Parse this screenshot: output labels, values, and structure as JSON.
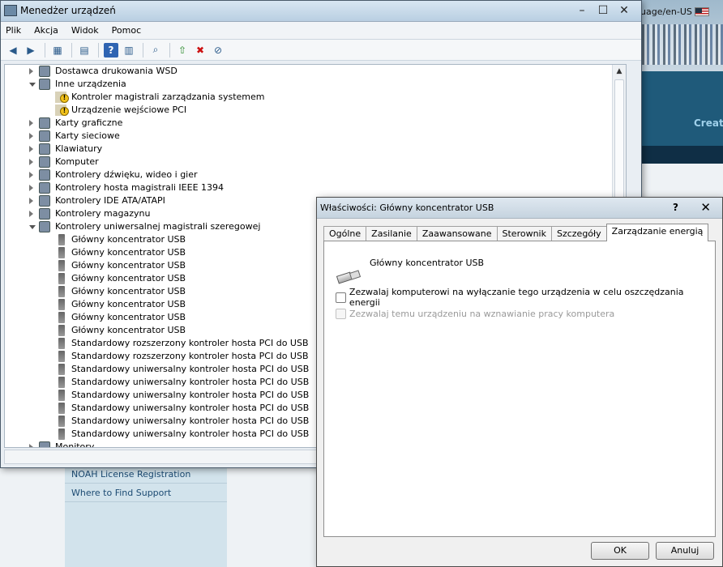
{
  "background": {
    "url_fragment": "uage/en-US",
    "band_text": "Creat",
    "links": [
      "NOAH License Registration",
      "Where to Find Support"
    ]
  },
  "device_manager": {
    "title": "Menedżer urządzeń",
    "menu": [
      "Plik",
      "Akcja",
      "Widok",
      "Pomoc"
    ],
    "tree": [
      {
        "label": "Dostawca drukowania WSD",
        "level": 0,
        "state": "closed",
        "icon": "printer-icon"
      },
      {
        "label": "Inne urządzenia",
        "level": 0,
        "state": "open",
        "icon": "unknown-device-icon"
      },
      {
        "label": "Kontroler magistrali zarządzania systemem",
        "level": 1,
        "state": "none",
        "icon": "warning-device-icon"
      },
      {
        "label": "Urządzenie wejściowe PCI",
        "level": 1,
        "state": "none",
        "icon": "warning-device-icon"
      },
      {
        "label": "Karty graficzne",
        "level": 0,
        "state": "closed",
        "icon": "display-adapter-icon"
      },
      {
        "label": "Karty sieciowe",
        "level": 0,
        "state": "closed",
        "icon": "network-adapter-icon"
      },
      {
        "label": "Klawiatury",
        "level": 0,
        "state": "closed",
        "icon": "keyboard-icon"
      },
      {
        "label": "Komputer",
        "level": 0,
        "state": "closed",
        "icon": "computer-icon"
      },
      {
        "label": "Kontrolery dźwięku, wideo i gier",
        "level": 0,
        "state": "closed",
        "icon": "sound-icon"
      },
      {
        "label": "Kontrolery hosta magistrali IEEE 1394",
        "level": 0,
        "state": "closed",
        "icon": "firewire-icon"
      },
      {
        "label": "Kontrolery IDE ATA/ATAPI",
        "level": 0,
        "state": "closed",
        "icon": "ide-controller-icon"
      },
      {
        "label": "Kontrolery magazynu",
        "level": 0,
        "state": "closed",
        "icon": "storage-controller-icon"
      },
      {
        "label": "Kontrolery uniwersalnej magistrali szeregowej",
        "level": 0,
        "state": "open",
        "icon": "usb-icon"
      },
      {
        "label": "Główny koncentrator USB",
        "level": 1,
        "state": "none",
        "icon": "usb-icon"
      },
      {
        "label": "Główny koncentrator USB",
        "level": 1,
        "state": "none",
        "icon": "usb-icon"
      },
      {
        "label": "Główny koncentrator USB",
        "level": 1,
        "state": "none",
        "icon": "usb-icon"
      },
      {
        "label": "Główny koncentrator USB",
        "level": 1,
        "state": "none",
        "icon": "usb-icon"
      },
      {
        "label": "Główny koncentrator USB",
        "level": 1,
        "state": "none",
        "icon": "usb-icon"
      },
      {
        "label": "Główny koncentrator USB",
        "level": 1,
        "state": "none",
        "icon": "usb-icon"
      },
      {
        "label": "Główny koncentrator USB",
        "level": 1,
        "state": "none",
        "icon": "usb-icon"
      },
      {
        "label": "Główny koncentrator USB",
        "level": 1,
        "state": "none",
        "icon": "usb-icon"
      },
      {
        "label": "Standardowy rozszerzony kontroler hosta PCI do USB",
        "level": 1,
        "state": "none",
        "icon": "usb-icon"
      },
      {
        "label": "Standardowy rozszerzony kontroler hosta PCI do USB",
        "level": 1,
        "state": "none",
        "icon": "usb-icon"
      },
      {
        "label": "Standardowy uniwersalny kontroler hosta PCI do USB",
        "level": 1,
        "state": "none",
        "icon": "usb-icon"
      },
      {
        "label": "Standardowy uniwersalny kontroler hosta PCI do USB",
        "level": 1,
        "state": "none",
        "icon": "usb-icon"
      },
      {
        "label": "Standardowy uniwersalny kontroler hosta PCI do USB",
        "level": 1,
        "state": "none",
        "icon": "usb-icon"
      },
      {
        "label": "Standardowy uniwersalny kontroler hosta PCI do USB",
        "level": 1,
        "state": "none",
        "icon": "usb-icon"
      },
      {
        "label": "Standardowy uniwersalny kontroler hosta PCI do USB",
        "level": 1,
        "state": "none",
        "icon": "usb-icon"
      },
      {
        "label": "Standardowy uniwersalny kontroler hosta PCI do USB",
        "level": 1,
        "state": "none",
        "icon": "usb-icon"
      },
      {
        "label": "Monitory",
        "level": 0,
        "state": "closed",
        "icon": "monitor-icon"
      }
    ]
  },
  "properties_dialog": {
    "title": "Właściwości: Główny koncentrator USB",
    "help": "?",
    "close": "✕",
    "tabs": [
      "Ogólne",
      "Zasilanie",
      "Zaawansowane",
      "Sterownik",
      "Szczegóły",
      "Zarządzanie energią"
    ],
    "active_tab": 5,
    "device_name": "Główny koncentrator USB",
    "checkbox_allow_off": "Zezwalaj komputerowi na wyłączanie tego urządzenia w celu oszczędzania energii",
    "checkbox_allow_wake": "Zezwalaj temu urządzeniu na wznawianie pracy komputera",
    "ok": "OK",
    "cancel": "Anuluj"
  }
}
